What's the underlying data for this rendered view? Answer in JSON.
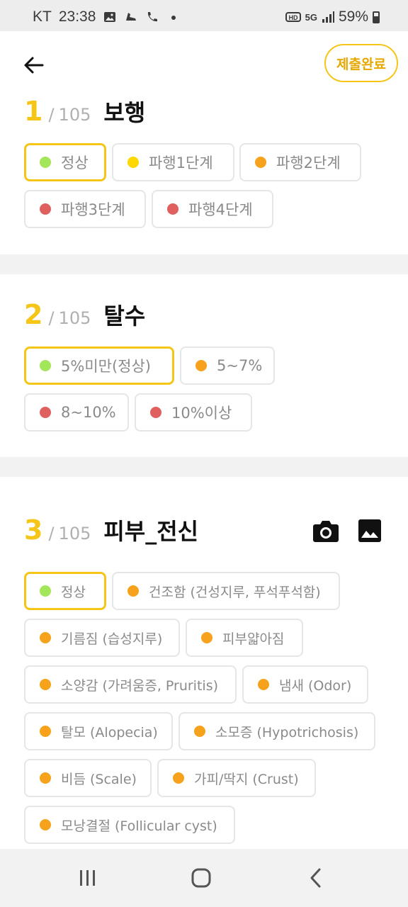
{
  "status_bar": {
    "carrier": "KT",
    "time": "23:38",
    "network": "5G",
    "battery": "59%"
  },
  "header": {
    "back_icon": "arrow-left-icon",
    "submit_label": "제출완료"
  },
  "questions": [
    {
      "number": "1",
      "slash": "/",
      "total": "105",
      "title": "보행",
      "options": [
        {
          "label": "정상",
          "color": "#a4e65a",
          "selected": true
        },
        {
          "label": "파행1단계",
          "color": "#ffd800",
          "selected": false
        },
        {
          "label": "파행2단계",
          "color": "#f7a21c",
          "selected": false
        },
        {
          "label": "파행3단계",
          "color": "#e06060",
          "selected": false
        },
        {
          "label": "파행4단계",
          "color": "#e06060",
          "selected": false
        }
      ]
    },
    {
      "number": "2",
      "slash": "/",
      "total": "105",
      "title": "탈수",
      "options": [
        {
          "label": "5%미만(정상)",
          "color": "#a4e65a",
          "selected": true
        },
        {
          "label": "5~7%",
          "color": "#f7a21c",
          "selected": false
        },
        {
          "label": "8~10%",
          "color": "#e06060",
          "selected": false
        },
        {
          "label": "10%이상",
          "color": "#e06060",
          "selected": false
        }
      ]
    },
    {
      "number": "3",
      "slash": "/",
      "total": "105",
      "title": "피부_전신",
      "icons": [
        "camera-icon",
        "image-icon"
      ],
      "options": [
        {
          "label": "정상",
          "color": "#a4e65a",
          "selected": true
        },
        {
          "label": "건조함 (건성지루, 푸석푸석함)",
          "color": "#f7a21c",
          "selected": false
        },
        {
          "label": "기름짐 (습성지루)",
          "color": "#f7a21c",
          "selected": false
        },
        {
          "label": "피부얇아짐",
          "color": "#f7a21c",
          "selected": false
        },
        {
          "label": "소양감 (가려움증, Pruritis)",
          "color": "#f7a21c",
          "selected": false
        },
        {
          "label": "냄새 (Odor)",
          "color": "#f7a21c",
          "selected": false
        },
        {
          "label": "탈모 (Alopecia)",
          "color": "#f7a21c",
          "selected": false
        },
        {
          "label": "소모증 (Hypotrichosis)",
          "color": "#f7a21c",
          "selected": false
        },
        {
          "label": "비듬 (Scale)",
          "color": "#f7a21c",
          "selected": false
        },
        {
          "label": "가피/딱지 (Crust)",
          "color": "#f7a21c",
          "selected": false
        },
        {
          "label": "모낭결절 (Follicular cyst)",
          "color": "#f7a21c",
          "selected": false
        }
      ]
    }
  ],
  "nav_bar": {
    "icons": [
      "recent-apps-icon",
      "home-icon",
      "back-icon"
    ]
  }
}
